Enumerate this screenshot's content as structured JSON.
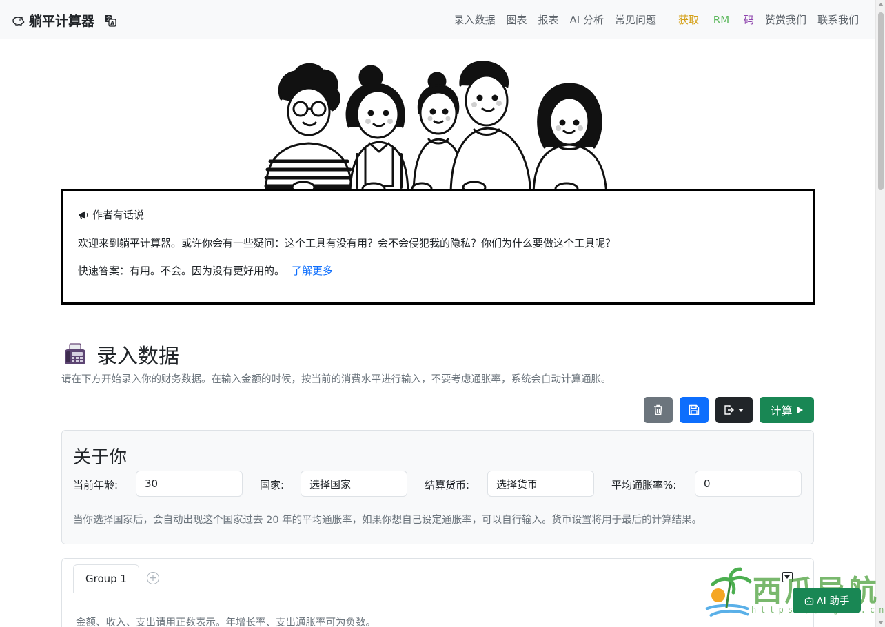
{
  "navbar": {
    "brand": "躺平计算器",
    "brand_icon": "piggy-bank-icon",
    "lang_icon": "translate-icon",
    "links": [
      "录入数据",
      "图表",
      "报表",
      "AI 分析",
      "常见问题"
    ],
    "rm_link": {
      "part1": "获取",
      "part2": "RM",
      "part3": "码"
    },
    "links_after": [
      "赞赏我们",
      "联系我们"
    ],
    "colors": {
      "rm_1": "#d4a017",
      "rm_2": "#5cb85c",
      "rm_3": "#8e44ad"
    }
  },
  "author_box": {
    "title": "作者有话说",
    "title_icon": "megaphone-icon",
    "line1": "欢迎来到躺平计算器。或许你会有一些疑问：这个工具有没有用？会不会侵犯我的隐私？你们为什么要做这个工具呢？",
    "line2": "快速答案：有用。不会。因为没有更好用的。",
    "link": "了解更多"
  },
  "data_entry": {
    "title": "录入数据",
    "title_icon": "fax-machine-icon",
    "description": "请在下方开始录入你的财务数据。在输入金额的时候，按当前的消费水平进行输入，不要考虑通胀率，系统会自动计算通胀。",
    "toolbar": {
      "trash_icon": "trash-icon",
      "save_icon": "save-icon",
      "export_icon": "export-icon",
      "calc_label": "计算",
      "colors": {
        "trash": "#6c757d",
        "save": "#0d6efd",
        "export": "#212529",
        "calc": "#198754"
      }
    }
  },
  "about": {
    "title": "关于你",
    "age_label": "当前年龄:",
    "age_value": "30",
    "country_label": "国家:",
    "country_value": "选择国家",
    "currency_label": "结算货币:",
    "currency_value": "选择货币",
    "inflation_label": "平均通胀率%:",
    "inflation_value": "0",
    "note": "当你选择国家后，会自动出现这个国家过去 20 年的平均通胀率，如果你想自己设定通胀率，可以自行输入。货币设置将用于最后的计算结果。"
  },
  "groups": {
    "tabs": [
      "Group 1"
    ],
    "add_tab": "+",
    "note": "金额、收入、支出请用正数表示。年增长率、支出通胀率可为负数。"
  },
  "watermark": {
    "text": "西瓜导航",
    "url": "https://xgdh.cn"
  },
  "ai_assistant": {
    "label": "AI 助手",
    "icon": "robot-icon"
  }
}
